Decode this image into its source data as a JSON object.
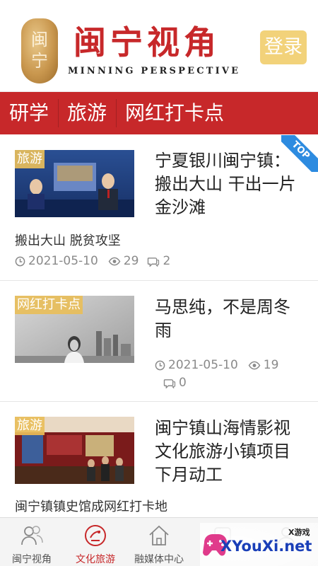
{
  "header": {
    "brand_cn": "闽宁视角",
    "brand_en": "MINNING  PERSPECTIVE",
    "seal_text": "闽宁",
    "login_label": "登录"
  },
  "categories": [
    "研学",
    "旅游",
    "网红打卡点"
  ],
  "articles": [
    {
      "tag": "旅游",
      "title": "宁夏银川闽宁镇：搬出大山 干出一片金沙滩",
      "summary": "搬出大山 脱贫攻坚",
      "date": "2021-05-10",
      "views": "29",
      "comments": "2",
      "badge": "TOP"
    },
    {
      "tag": "网红打卡点",
      "title": "马思纯，不是周冬雨",
      "date": "2021-05-10",
      "views": "19",
      "comments": "0"
    },
    {
      "tag": "旅游",
      "title": "闽宁镇山海情影视文化旅游小镇项目下月动工",
      "summary": "闽宁镇镇史馆成网红打卡地"
    }
  ],
  "bottom_nav": [
    {
      "label": "闽宁视角",
      "icon": "people-icon",
      "active": false
    },
    {
      "label": "文化旅游",
      "icon": "culture-tour-icon",
      "active": true
    },
    {
      "label": "融媒体中心",
      "icon": "home-icon",
      "active": false
    },
    {
      "label": "",
      "icon": "service-icon",
      "active": false
    },
    {
      "label": "",
      "icon": "profile-icon",
      "active": false
    }
  ],
  "watermark": {
    "small": "X游戏",
    "big": "XYouXi.net"
  },
  "colors": {
    "brand_red": "#c7282a",
    "login_bg": "#f2d27a",
    "tag_bg": "#e8be5a",
    "top_badge": "#2d8be0",
    "meta_gray": "#8a8a8a"
  }
}
